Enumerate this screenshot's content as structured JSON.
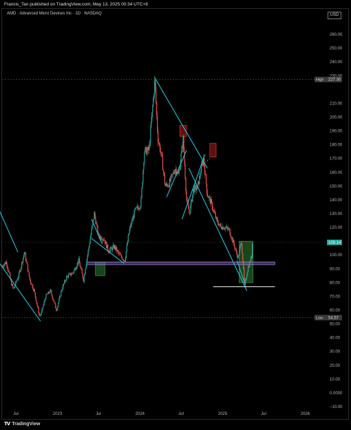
{
  "header": {
    "published_by": "Francis_Tan published on TradingView.com, May 13, 2025 00:34 UTC+8",
    "symbol_line": "AMD · Advanced Micro Devices Inc · 1D · NASDAQ",
    "currency_button": "USD"
  },
  "footer": {
    "brand": "TradingView",
    "logo_icon": "tradingview-logo-icon"
  },
  "colors": {
    "up": "#26a69a",
    "down": "#ef5350",
    "trendline": "#22c4d9",
    "support_band": "#7e57c2",
    "horizontal_line": "#ffffff",
    "demand_zone": "#2e7d32",
    "supply_zone": "#b71c1c"
  },
  "chart_data": {
    "type": "candlestick",
    "symbol": "AMD",
    "timeframe": "1D",
    "ylim": [
      -10,
      270
    ],
    "xlim": [
      "2022-05-01",
      "2026-04-01"
    ],
    "y_ticks": [
      260,
      250,
      240,
      230,
      210,
      200,
      190,
      180,
      170,
      160,
      150,
      140,
      130,
      120,
      100,
      90,
      80,
      70,
      60,
      50,
      40,
      30,
      20,
      10,
      0,
      -10
    ],
    "y_tick_labels": [
      "260.00",
      "250.00",
      "240.00",
      "230.00",
      "210.00",
      "200.00",
      "190.00",
      "180.00",
      "170.00",
      "160.00",
      "150.00",
      "140.00",
      "130.00",
      "120.00",
      "100.00",
      "90.00",
      "80.00",
      "70.00",
      "60.00",
      "50.00",
      "40.00",
      "30.00",
      "20.00",
      "10.00",
      "0.0000",
      "−10.00"
    ],
    "x_ticks": [
      {
        "label": "Jul",
        "date": "2022-07-01"
      },
      {
        "label": "2023",
        "date": "2023-01-01"
      },
      {
        "label": "Jul",
        "date": "2023-07-01"
      },
      {
        "label": "2024",
        "date": "2024-01-01"
      },
      {
        "label": "Jul",
        "date": "2024-07-01"
      },
      {
        "label": "2025",
        "date": "2025-01-01"
      },
      {
        "label": "Jul",
        "date": "2025-07-01"
      },
      {
        "label": "2026",
        "date": "2026-01-01"
      }
    ],
    "price_path": [
      [
        "2022-05-01",
        92
      ],
      [
        "2022-05-20",
        95
      ],
      [
        "2022-06-10",
        80
      ],
      [
        "2022-06-20",
        75
      ],
      [
        "2022-07-15",
        86
      ],
      [
        "2022-08-08",
        102
      ],
      [
        "2022-09-01",
        82
      ],
      [
        "2022-09-20",
        74
      ],
      [
        "2022-10-13",
        56
      ],
      [
        "2022-10-20",
        57
      ],
      [
        "2022-11-10",
        70
      ],
      [
        "2022-12-01",
        74
      ],
      [
        "2022-12-28",
        60
      ],
      [
        "2023-01-20",
        75
      ],
      [
        "2023-02-10",
        84
      ],
      [
        "2023-03-10",
        87
      ],
      [
        "2023-04-05",
        96
      ],
      [
        "2023-04-26",
        82
      ],
      [
        "2023-05-20",
        106
      ],
      [
        "2023-06-13",
        130
      ],
      [
        "2023-07-01",
        114
      ],
      [
        "2023-07-25",
        112
      ],
      [
        "2023-08-15",
        103
      ],
      [
        "2023-09-10",
        106
      ],
      [
        "2023-10-02",
        100
      ],
      [
        "2023-10-26",
        96
      ],
      [
        "2023-11-15",
        118
      ],
      [
        "2023-12-10",
        132
      ],
      [
        "2024-01-05",
        137
      ],
      [
        "2024-01-20",
        175
      ],
      [
        "2024-02-10",
        176
      ],
      [
        "2024-03-07",
        227
      ],
      [
        "2024-03-20",
        185
      ],
      [
        "2024-04-05",
        172
      ],
      [
        "2024-04-22",
        150
      ],
      [
        "2024-05-10",
        152
      ],
      [
        "2024-06-05",
        163
      ],
      [
        "2024-06-20",
        158
      ],
      [
        "2024-07-10",
        184
      ],
      [
        "2024-07-25",
        140
      ],
      [
        "2024-08-07",
        130
      ],
      [
        "2024-08-25",
        148
      ],
      [
        "2024-09-10",
        148
      ],
      [
        "2024-10-08",
        170
      ],
      [
        "2024-10-25",
        144
      ],
      [
        "2024-11-10",
        138
      ],
      [
        "2024-12-05",
        125
      ],
      [
        "2024-12-20",
        121
      ],
      [
        "2025-01-10",
        120
      ],
      [
        "2025-01-30",
        118
      ],
      [
        "2025-02-15",
        110
      ],
      [
        "2025-03-10",
        98
      ],
      [
        "2025-03-25",
        110
      ],
      [
        "2025-04-08",
        77
      ],
      [
        "2025-04-22",
        90
      ],
      [
        "2025-05-09",
        99
      ],
      [
        "2025-05-12",
        109.14
      ]
    ],
    "last_price": "109.14",
    "high": {
      "label": "High",
      "value": "227.30"
    },
    "low": {
      "label": "Low",
      "value": "54.57"
    },
    "annotations": {
      "trendlines": [
        {
          "from": [
            "2022-04-20",
            132
          ],
          "to": [
            "2022-07-10",
            102
          ]
        },
        {
          "from": [
            "2022-04-20",
            94
          ],
          "to": [
            "2022-10-18",
            52
          ]
        },
        {
          "from": [
            "2023-06-01",
            126
          ],
          "to": [
            "2023-07-18",
            108
          ]
        },
        {
          "from": [
            "2023-06-01",
            112
          ],
          "to": [
            "2023-10-22",
            94
          ]
        },
        {
          "from": [
            "2024-03-05",
            229
          ],
          "to": [
            "2024-10-25",
            163
          ]
        },
        {
          "from": [
            "2024-04-28",
            142
          ],
          "to": [
            "2024-07-25",
            176
          ]
        },
        {
          "from": [
            "2024-08-04",
            163
          ],
          "to": [
            "2025-04-18",
            74
          ]
        },
        {
          "from": [
            "2024-07-05",
            126
          ],
          "to": [
            "2024-10-15",
            173
          ]
        },
        {
          "from": [
            "2025-03-05",
            96
          ],
          "to": [
            "2025-04-12",
            78
          ]
        }
      ],
      "support_band": {
        "from": "2023-05-10",
        "to": "2025-08-20",
        "y_top": 95,
        "y_bottom": 93
      },
      "horizontal_line": {
        "from": "2024-11-20",
        "to": "2025-08-20",
        "y": 77
      },
      "dotted_line": {
        "from": "2024-09-30",
        "to": "2024-11-05",
        "y1": 165,
        "y2": 170
      },
      "demand_zones": [
        {
          "from": "2023-06-18",
          "to": "2023-07-30",
          "y_top": 95,
          "y_bottom": 85
        },
        {
          "from": "2025-03-15",
          "to": "2025-05-15",
          "y_top": 110,
          "y_bottom": 80
        }
      ],
      "supply_zones": [
        {
          "from": "2024-06-25",
          "to": "2024-07-25",
          "y_top": 194,
          "y_bottom": 186
        },
        {
          "from": "2024-11-05",
          "to": "2024-12-03",
          "y_top": 181,
          "y_bottom": 171
        }
      ]
    }
  }
}
